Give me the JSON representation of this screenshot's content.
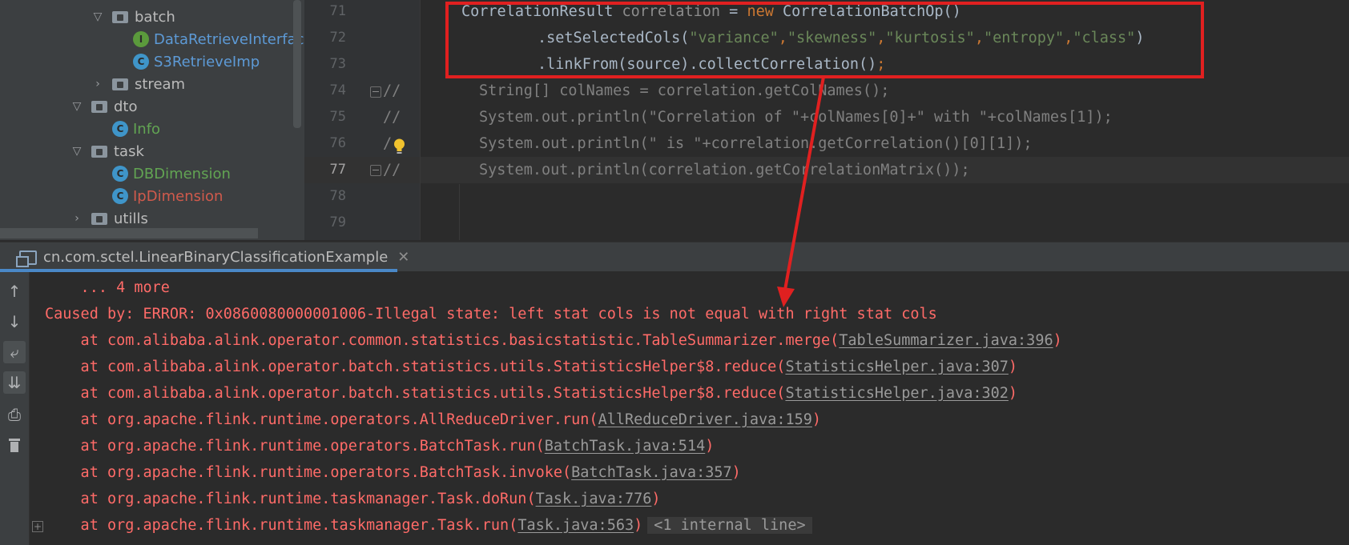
{
  "project_tree": {
    "items": [
      {
        "label": "batch",
        "kind": "folder",
        "expanded": true
      },
      {
        "label": "DataRetrieveInterfac",
        "kind": "interface",
        "badge": "I"
      },
      {
        "label": "S3RetrieveImp",
        "kind": "class",
        "badge": "C"
      },
      {
        "label": "stream",
        "kind": "folder",
        "expanded": false
      },
      {
        "label": "dto",
        "kind": "folder",
        "expanded": true
      },
      {
        "label": "Info",
        "kind": "class",
        "badge": "C"
      },
      {
        "label": "task",
        "kind": "folder",
        "expanded": true
      },
      {
        "label": "DBDimension",
        "kind": "class",
        "badge": "C"
      },
      {
        "label": "IpDimension",
        "kind": "class",
        "badge": "C"
      },
      {
        "label": "utills",
        "kind": "folder",
        "expanded": false
      }
    ]
  },
  "editor": {
    "line_numbers": [
      "71",
      "72",
      "73",
      "74",
      "75",
      "76",
      "77",
      "78",
      "79"
    ],
    "current_line": "77",
    "code": {
      "l71": {
        "type": "CorrelationResult ",
        "var": "correlation",
        "eq": " = ",
        "kw": "new",
        "rest": " CorrelationBatchOp()"
      },
      "l72": {
        "pre": ".setSelectedCols(",
        "s1": "\"variance\"",
        "s2": "\"skewness\"",
        "s3": "\"kurtosis\"",
        "s4": "\"entropy\"",
        "s5": "\"class\"",
        "post": ")"
      },
      "l73": {
        "pre": ".linkFrom(source).collectCorrelation()",
        "semi": ";"
      },
      "l74": {
        "marker": "//",
        "text": "String[] colNames = correlation.getColNames();"
      },
      "l75": {
        "marker": "//",
        "text": "System.out.println(\"Correlation of \"+colNames[0]+\" with \"+colNames[1]);"
      },
      "l76": {
        "marker": "/",
        "text": "System.out.println(\" is \"+correlation.getCorrelation()[0][1]);"
      },
      "l77": {
        "marker": "//",
        "text": "System.out.println(correlation.getCorrelationMatrix());"
      }
    }
  },
  "run_panel": {
    "tab_label": "cn.com.sctel.LinearBinaryClassificationExample",
    "close_glyph": "✕",
    "toolbar": [
      {
        "name": "up-arrow-icon",
        "glyph": "↑"
      },
      {
        "name": "down-arrow-icon",
        "glyph": "↓"
      },
      {
        "name": "soft-wrap-icon",
        "glyph": "⤶"
      },
      {
        "name": "scroll-to-end-icon",
        "glyph": "⇊"
      },
      {
        "name": "print-icon",
        "glyph": "⎙"
      },
      {
        "name": "trash-icon",
        "glyph": "🗑"
      }
    ],
    "console": {
      "more": "    ... 4 more",
      "caused_by": "Caused by: ERROR: 0x0860080000001006-Illegal state: left stat cols is not equal with right stat cols",
      "frames": [
        {
          "text": "    at com.alibaba.alink.operator.common.statistics.basicstatistic.TableSummarizer.merge(",
          "link": "TableSummarizer.java:396",
          "end": ")"
        },
        {
          "text": "    at com.alibaba.alink.operator.batch.statistics.utils.StatisticsHelper$8.reduce(",
          "link": "StatisticsHelper.java:307",
          "end": ")"
        },
        {
          "text": "    at com.alibaba.alink.operator.batch.statistics.utils.StatisticsHelper$8.reduce(",
          "link": "StatisticsHelper.java:302",
          "end": ")"
        },
        {
          "text": "    at org.apache.flink.runtime.operators.AllReduceDriver.run(",
          "link": "AllReduceDriver.java:159",
          "end": ")"
        },
        {
          "text": "    at org.apache.flink.runtime.operators.BatchTask.run(",
          "link": "BatchTask.java:514",
          "end": ")"
        },
        {
          "text": "    at org.apache.flink.runtime.operators.BatchTask.invoke(",
          "link": "BatchTask.java:357",
          "end": ")"
        },
        {
          "text": "    at org.apache.flink.runtime.taskmanager.Task.doRun(",
          "link": "Task.java:776",
          "end": ")"
        },
        {
          "text": "    at org.apache.flink.runtime.taskmanager.Task.run(",
          "link": "Task.java:563",
          "end": ")"
        }
      ],
      "internal_line": "<1 internal line>",
      "expand_glyph": "+"
    }
  },
  "colors": {
    "error_text": "#ff6b68",
    "annotation_red": "#e02020",
    "keyword": "#cc7832",
    "string": "#6a8759"
  }
}
